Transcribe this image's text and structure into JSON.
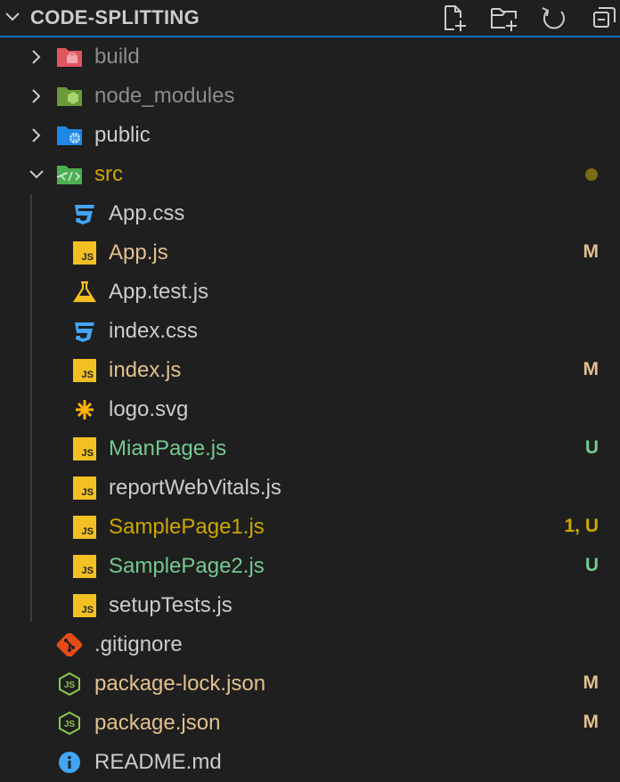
{
  "header": {
    "title": "CODE-SPLITTING",
    "actions": [
      "new-file",
      "new-folder",
      "refresh",
      "collapse-all"
    ]
  },
  "colors": {
    "default_text": "#cccccc",
    "modified": "#e2c08d",
    "untracked": "#73c991",
    "error_modified": "#cca700",
    "ignored": "#8c8c8c",
    "accent_line": "#0e70c0"
  },
  "tree": [
    {
      "label": "build",
      "kind": "folder",
      "expanded": false,
      "icon": "folder-build-icon",
      "decoration": ""
    },
    {
      "label": "node_modules",
      "kind": "folder",
      "expanded": false,
      "icon": "folder-node-icon",
      "decoration": ""
    },
    {
      "label": "public",
      "kind": "folder",
      "expanded": false,
      "icon": "folder-public-icon",
      "decoration": ""
    },
    {
      "label": "src",
      "kind": "folder",
      "expanded": true,
      "icon": "folder-src-icon",
      "decoration": "●"
    },
    {
      "label": "App.css",
      "kind": "file",
      "icon": "css-icon",
      "decoration": ""
    },
    {
      "label": "App.js",
      "kind": "file",
      "icon": "js-icon",
      "decoration": "M"
    },
    {
      "label": "App.test.js",
      "kind": "file",
      "icon": "test-flask-icon",
      "decoration": ""
    },
    {
      "label": "index.css",
      "kind": "file",
      "icon": "css-icon",
      "decoration": ""
    },
    {
      "label": "index.js",
      "kind": "file",
      "icon": "js-icon",
      "decoration": "M"
    },
    {
      "label": "logo.svg",
      "kind": "file",
      "icon": "svg-asterisk-icon",
      "decoration": ""
    },
    {
      "label": "MianPage.js",
      "kind": "file",
      "icon": "js-icon",
      "decoration": "U"
    },
    {
      "label": "reportWebVitals.js",
      "kind": "file",
      "icon": "js-icon",
      "decoration": ""
    },
    {
      "label": "SamplePage1.js",
      "kind": "file",
      "icon": "js-icon",
      "decoration": "1, U"
    },
    {
      "label": "SamplePage2.js",
      "kind": "file",
      "icon": "js-icon",
      "decoration": "U"
    },
    {
      "label": "setupTests.js",
      "kind": "file",
      "icon": "js-icon",
      "decoration": ""
    },
    {
      "label": ".gitignore",
      "kind": "file",
      "icon": "git-icon",
      "decoration": ""
    },
    {
      "label": "package-lock.json",
      "kind": "file",
      "icon": "nodejs-icon",
      "decoration": "M"
    },
    {
      "label": "package.json",
      "kind": "file",
      "icon": "nodejs-icon",
      "decoration": "M"
    },
    {
      "label": "README.md",
      "kind": "file",
      "icon": "info-icon",
      "decoration": ""
    }
  ]
}
